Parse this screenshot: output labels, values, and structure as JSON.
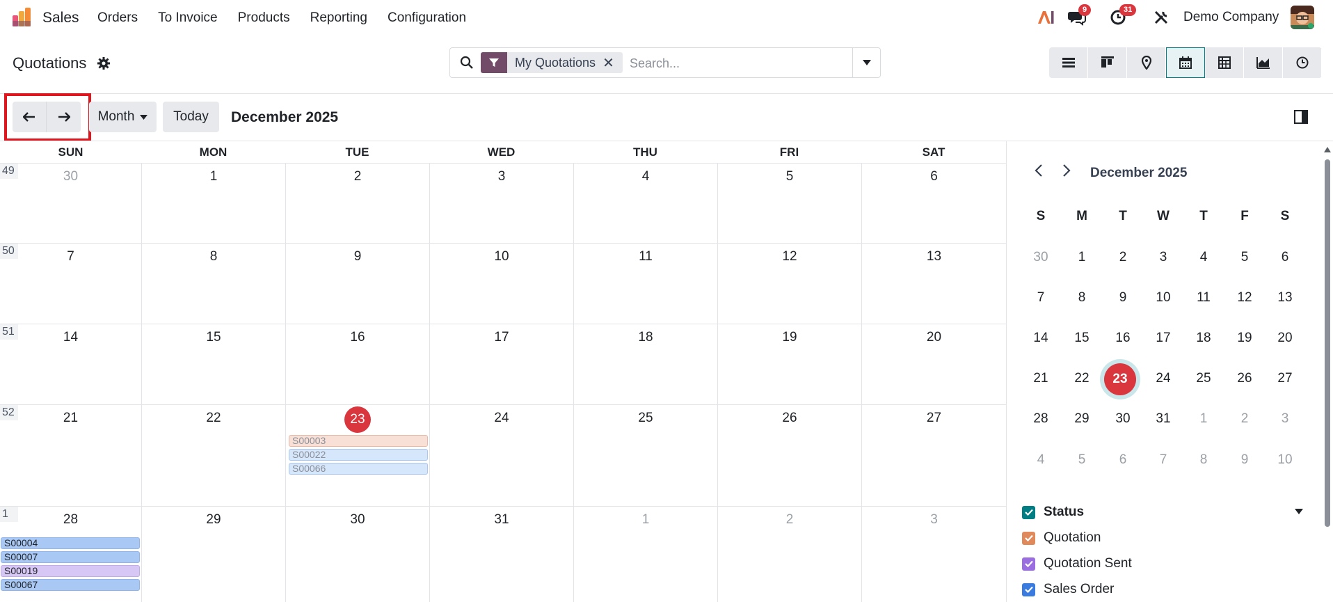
{
  "navbar": {
    "app_name": "Sales",
    "menu": [
      "Orders",
      "To Invoice",
      "Products",
      "Reporting",
      "Configuration"
    ],
    "messages_count": "9",
    "activities_count": "31",
    "company": "Demo Company"
  },
  "control_panel": {
    "title": "Quotations",
    "facet_label": "My Quotations",
    "search_placeholder": "Search...",
    "views": [
      "list-icon",
      "kanban-icon",
      "map-icon",
      "calendar-icon",
      "pivot-icon",
      "graph-icon",
      "activity-icon"
    ],
    "active_view": "calendar-icon"
  },
  "calendar": {
    "scale_label": "Month",
    "today_label": "Today",
    "range_title": "December 2025",
    "weekdays": [
      "SUN",
      "MON",
      "TUE",
      "WED",
      "THU",
      "FRI",
      "SAT"
    ],
    "weeks": [
      {
        "number": "49",
        "days": [
          "30",
          "1",
          "2",
          "3",
          "4",
          "5",
          "6"
        ],
        "muted": [
          true,
          false,
          false,
          false,
          false,
          false,
          false
        ]
      },
      {
        "number": "50",
        "days": [
          "7",
          "8",
          "9",
          "10",
          "11",
          "12",
          "13"
        ],
        "muted": [
          false,
          false,
          false,
          false,
          false,
          false,
          false
        ]
      },
      {
        "number": "51",
        "days": [
          "14",
          "15",
          "16",
          "17",
          "18",
          "19",
          "20"
        ],
        "muted": [
          false,
          false,
          false,
          false,
          false,
          false,
          false
        ]
      },
      {
        "number": "52",
        "days": [
          "21",
          "22",
          "23",
          "24",
          "25",
          "26",
          "27"
        ],
        "muted": [
          false,
          false,
          false,
          false,
          false,
          false,
          false
        ]
      },
      {
        "number": "1",
        "days": [
          "28",
          "29",
          "30",
          "31",
          "1",
          "2",
          "3"
        ],
        "muted": [
          false,
          false,
          false,
          false,
          true,
          true,
          true
        ]
      }
    ],
    "today": "23",
    "events": {
      "dec23": [
        "S00003",
        "S00022",
        "S00066"
      ],
      "dec28": [
        "S00004",
        "S00007",
        "S00019",
        "S00067"
      ]
    }
  },
  "side_panel": {
    "month_title": "December 2025",
    "weekdays": [
      "S",
      "M",
      "T",
      "W",
      "T",
      "F",
      "S"
    ],
    "weeks": [
      [
        "30",
        "1",
        "2",
        "3",
        "4",
        "5",
        "6"
      ],
      [
        "7",
        "8",
        "9",
        "10",
        "11",
        "12",
        "13"
      ],
      [
        "14",
        "15",
        "16",
        "17",
        "18",
        "19",
        "20"
      ],
      [
        "21",
        "22",
        "23",
        "24",
        "25",
        "26",
        "27"
      ],
      [
        "28",
        "29",
        "30",
        "31",
        "1",
        "2",
        "3"
      ],
      [
        "4",
        "5",
        "6",
        "7",
        "8",
        "9",
        "10"
      ]
    ],
    "filter_title": "Status",
    "filters": [
      {
        "label": "Quotation",
        "color": "#e08a5c"
      },
      {
        "label": "Quotation Sent",
        "color": "#9a6ee0"
      },
      {
        "label": "Sales Order",
        "color": "#3a7be0"
      }
    ]
  },
  "colors": {
    "brand": "#714b67",
    "accent": "#017e84",
    "today": "#d9363e"
  }
}
